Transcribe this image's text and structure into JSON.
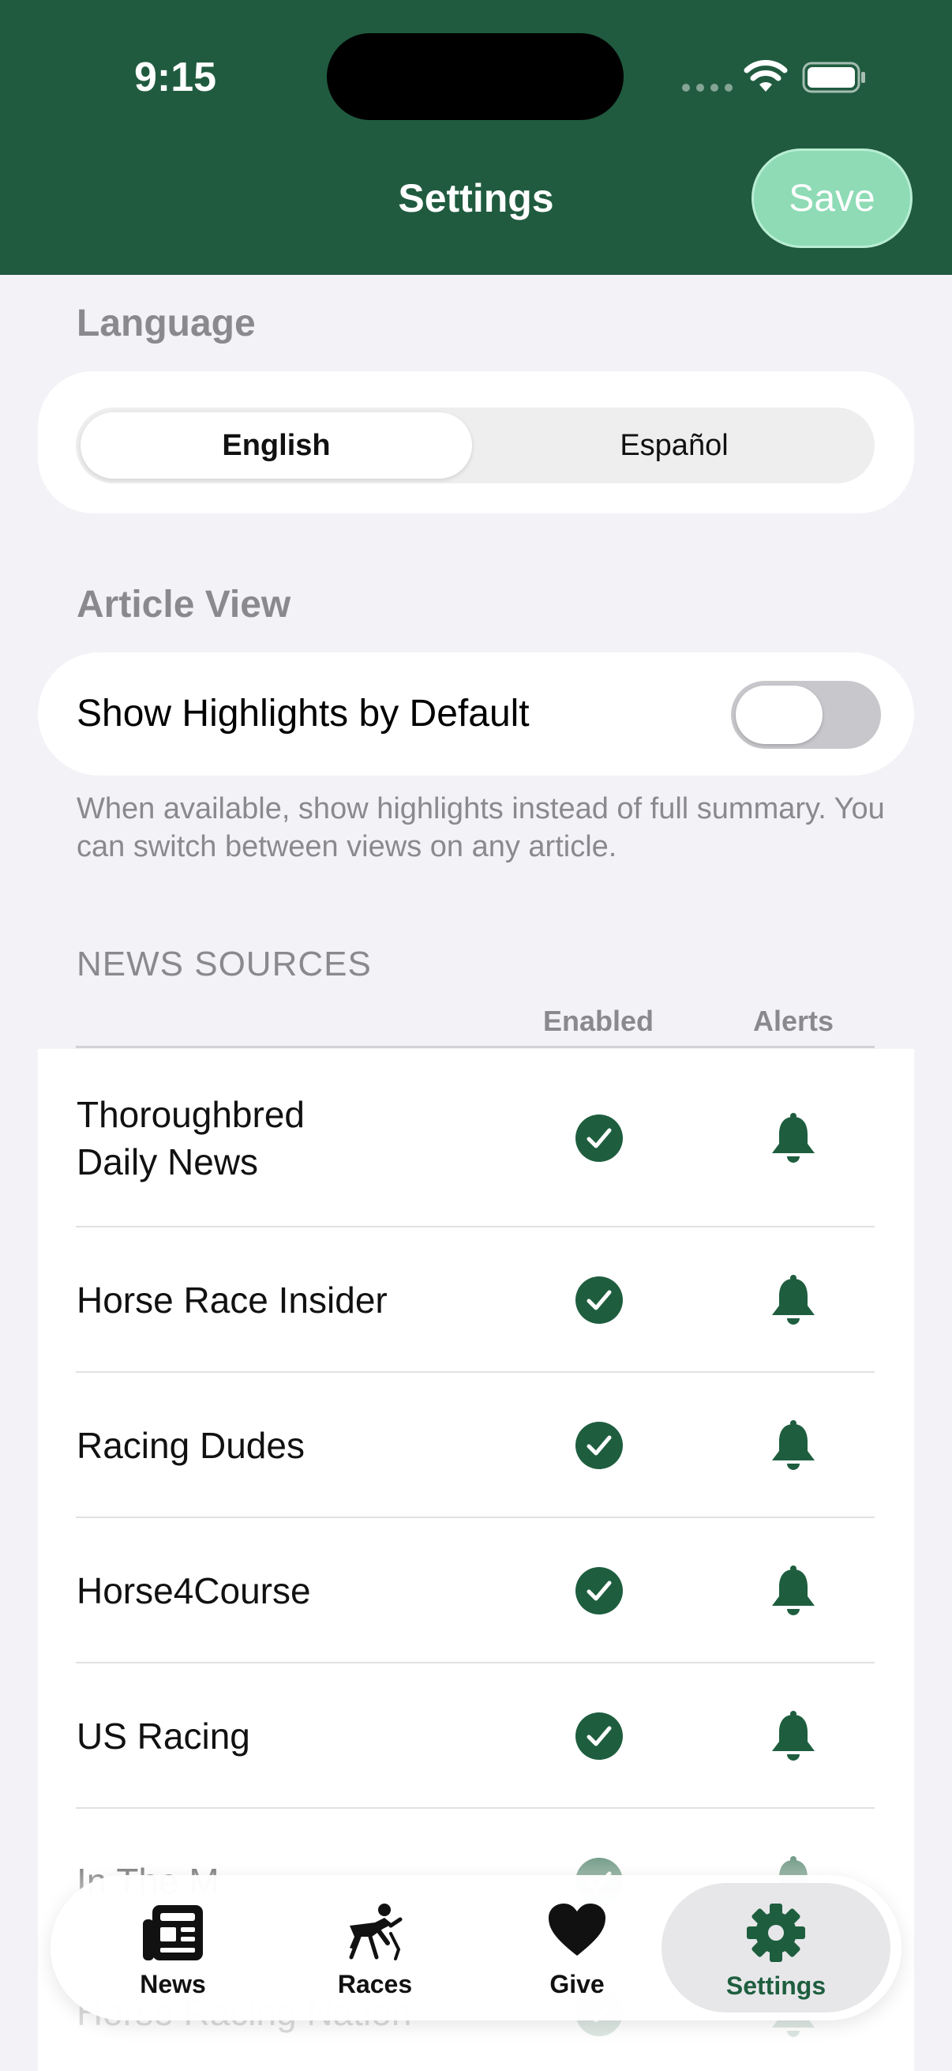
{
  "status_bar": {
    "time": "9:15"
  },
  "header": {
    "title": "Settings",
    "save_label": "Save"
  },
  "language": {
    "title": "Language",
    "options": [
      "English",
      "Español"
    ],
    "selected": "English"
  },
  "article_view": {
    "title": "Article View",
    "toggle_label": "Show Highlights by Default",
    "toggle_on": false,
    "footnote": "When available, show highlights instead of full summary. You can switch between views on any article."
  },
  "news_sources": {
    "title": "NEWS SOURCES",
    "columns": {
      "enabled": "Enabled",
      "alerts": "Alerts"
    },
    "items": [
      {
        "name": "Thoroughbred\nDaily News",
        "enabled": true,
        "alerts": true
      },
      {
        "name": "Horse Race Insider",
        "enabled": true,
        "alerts": true
      },
      {
        "name": "Racing Dudes",
        "enabled": true,
        "alerts": true
      },
      {
        "name": "Horse4Course",
        "enabled": true,
        "alerts": true
      },
      {
        "name": "US Racing",
        "enabled": true,
        "alerts": true
      },
      {
        "name": "In The M",
        "enabled": true,
        "alerts": true
      },
      {
        "name": "Horse Racing Nation",
        "enabled": true,
        "alerts": true
      }
    ]
  },
  "tab_bar": {
    "tabs": [
      {
        "label": "News",
        "icon": "newspaper-icon"
      },
      {
        "label": "Races",
        "icon": "horse-racing-icon"
      },
      {
        "label": "Give",
        "icon": "heart-icon"
      },
      {
        "label": "Settings",
        "icon": "gear-icon"
      }
    ],
    "active": "Settings"
  },
  "colors": {
    "brand_green": "#205B3F",
    "accent_mint": "#8EDBB5",
    "background": "#F2F2F7"
  }
}
